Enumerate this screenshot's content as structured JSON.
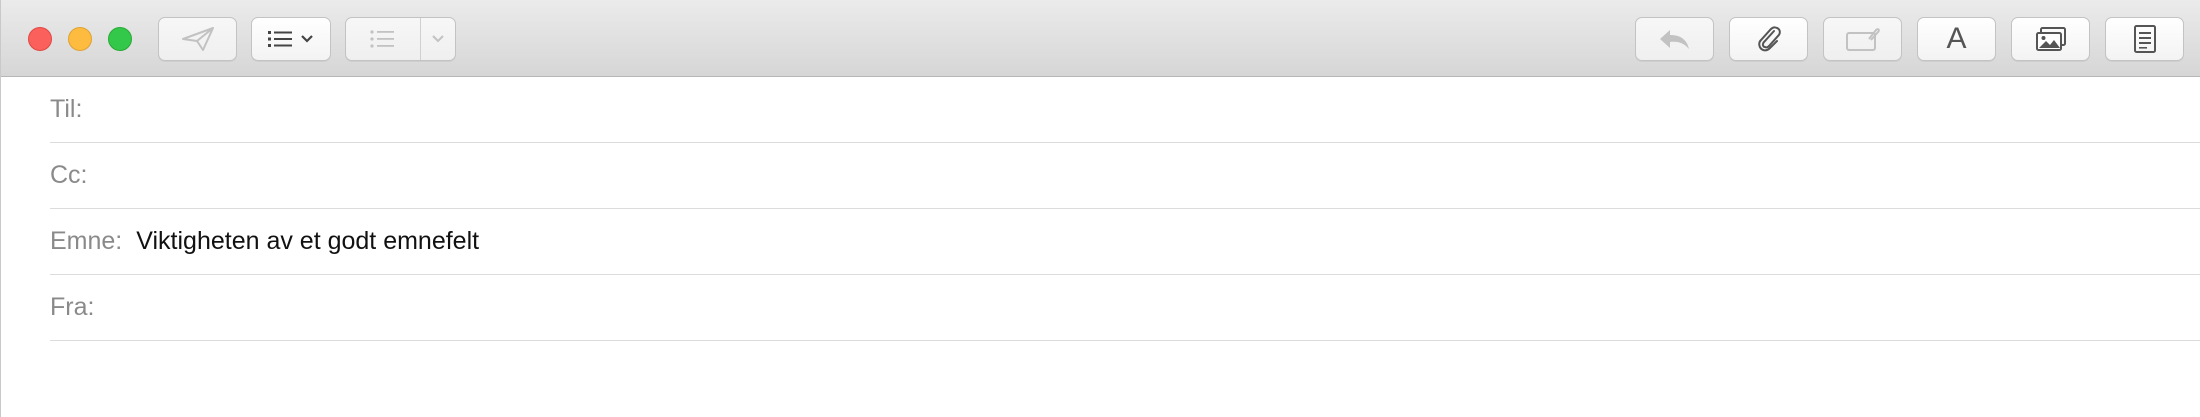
{
  "window": {
    "controls": {
      "close": "close-icon",
      "minimize": "minimize-icon",
      "zoom": "zoom-icon"
    }
  },
  "toolbar": {
    "left_buttons": [
      {
        "name": "send-button",
        "icon": "paper-plane-icon",
        "enabled": false
      },
      {
        "name": "header-fields-button",
        "icon": "list-icon",
        "has_dropdown": true,
        "enabled": true
      },
      {
        "name": "list-format-button",
        "icon": "bulleted-list-icon",
        "has_dropdown": true,
        "enabled": false
      }
    ],
    "right_buttons": [
      {
        "name": "reply-button",
        "icon": "reply-arrow-icon",
        "enabled": false
      },
      {
        "name": "attach-button",
        "icon": "paperclip-icon",
        "enabled": true
      },
      {
        "name": "markup-button",
        "icon": "annotate-attachment-icon",
        "enabled": false
      },
      {
        "name": "format-button",
        "icon": "font-icon",
        "label": "A",
        "enabled": true
      },
      {
        "name": "photo-browser-button",
        "icon": "photos-icon",
        "enabled": true
      },
      {
        "name": "stationery-button",
        "icon": "stationery-icon",
        "enabled": true
      }
    ]
  },
  "fields": {
    "to": {
      "label": "Til:",
      "value": ""
    },
    "cc": {
      "label": "Cc:",
      "value": ""
    },
    "subject": {
      "label": "Emne:",
      "value": "Viktigheten av et godt emnefelt"
    },
    "from": {
      "label": "Fra:",
      "value": ""
    }
  }
}
